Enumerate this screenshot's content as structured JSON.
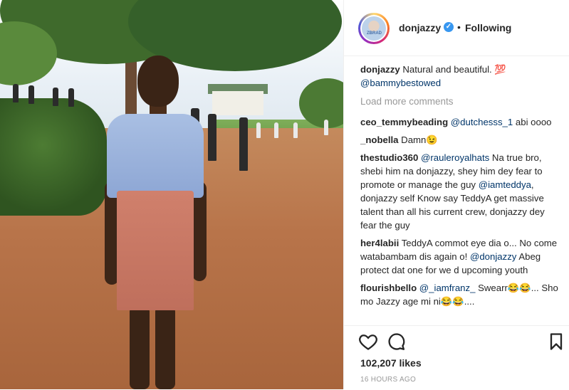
{
  "post": {
    "author": "donjazzy",
    "follow_state": "Following",
    "dot": "•",
    "avatar_text": "ZBRAD"
  },
  "caption": {
    "username": "donjazzy",
    "text": "Natural and beautiful. 💯",
    "mention": "@bammybestowed"
  },
  "load_more": "Load more comments",
  "comments": [
    {
      "username": "ceo_temmybeading",
      "mention": "@dutchesss_1",
      "text": " abi oooo"
    },
    {
      "username": "_nobella",
      "mention": "",
      "text": "Damn😉"
    },
    {
      "username": "thestudio360",
      "mention": "@rauleroyalhats",
      "text": " Na true bro, shebi him na donjazzy, shey him dey fear to promote or manage the guy ",
      "mention2": "@iamteddya",
      "text2": ", donjazzy self Know say TeddyA get massive talent than all his current crew, donjazzy dey fear the guy"
    },
    {
      "username": "her4labii",
      "mention": "",
      "text": "TeddyA commot eye dia o... No come watabambam dis again o! ",
      "mention2": "@donjazzy",
      "text2": " Abeg protect dat one for we d upcoming youth"
    },
    {
      "username": "flourishbello",
      "mention": "@_iamfranz_",
      "text": " Swearr😂😂... Sho mo Jazzy age mi ni😂😂...."
    }
  ],
  "likes": "102,207 likes",
  "timestamp": "16 HOURS AGO",
  "icons": {
    "like": "heart-icon",
    "comment": "speech-bubble-icon",
    "save": "bookmark-icon",
    "verified": "verified-badge-icon"
  },
  "colors": {
    "mention": "#003569",
    "muted": "#999999",
    "verified": "#3897f0"
  }
}
